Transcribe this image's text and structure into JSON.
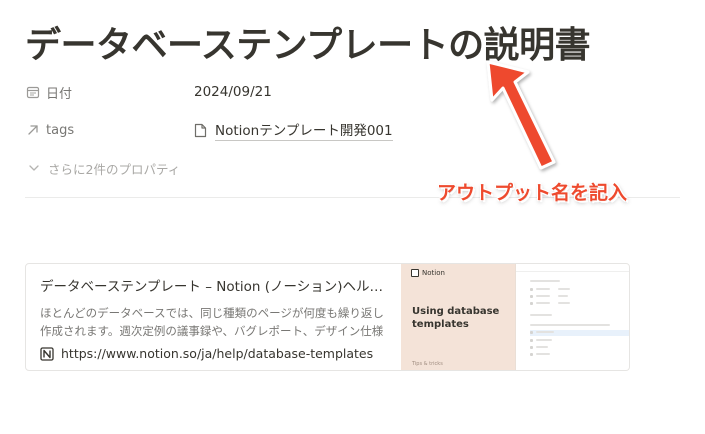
{
  "page": {
    "title": "データベーステンプレートの説明書"
  },
  "properties": [
    {
      "icon": "calendar-icon",
      "label": "日付",
      "value": "2024/09/21"
    },
    {
      "icon": "relation-arrow-icon",
      "label": "tags",
      "value": "Notionテンプレート開発001",
      "value_icon": "page-icon"
    }
  ],
  "more_properties": {
    "icon": "chevron-down-icon",
    "label": "さらに2件のプロパティ"
  },
  "bookmark": {
    "title": "データベーステンプレート – Notion (ノーション)ヘルプ…",
    "description": "ほとんどのデータベースでは、同じ種類のページが何度も繰り返し作成されます。週次定例の議事録や、バグレポート、デザイン仕様書な",
    "url": "https://www.notion.so/ja/help/database-templates",
    "favicon": "notion-logo-icon",
    "thumbnail": {
      "brand": "Notion",
      "heading": "Using database templates",
      "footer": "Tips & tricks"
    }
  },
  "annotation": {
    "text": "アウトプット名を記入",
    "color": "#ee4a2e"
  },
  "colors": {
    "text": "#37352f",
    "muted": "#787774",
    "faint": "#a9a8a5",
    "thumb_bg": "#f4e3d8"
  }
}
